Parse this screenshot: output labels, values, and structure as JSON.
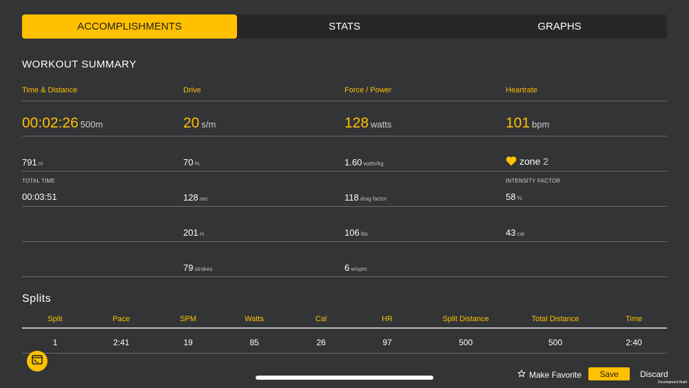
{
  "tabs": [
    {
      "label": "ACCOMPLISHMENTS",
      "active": true
    },
    {
      "label": "STATS",
      "active": false
    },
    {
      "label": "GRAPHS",
      "active": false
    }
  ],
  "summary": {
    "title": "WORKOUT SUMMARY",
    "time_distance": {
      "header": "Time & Distance",
      "main_value": "00:02:26",
      "main_unit": "500m",
      "distance_value": "791",
      "distance_unit": "m",
      "total_time_label": "TOTAL TIME",
      "total_time_value": "00:03:51"
    },
    "drive": {
      "header": "Drive",
      "main_value": "20",
      "main_unit": "s/m",
      "r1_value": "70",
      "r1_unit": "%",
      "r2_value": "128",
      "r2_unit": "sec",
      "r3_value": "201",
      "r3_unit": "m",
      "r4_value": "79",
      "r4_unit": "strokes"
    },
    "force": {
      "header": "Force / Power",
      "main_value": "128",
      "main_unit": "watts",
      "r1_value": "1.60",
      "r1_unit": "watts/kg",
      "r2_value": "118",
      "r2_unit": "drag factor",
      "r3_value": "106",
      "r3_unit": "lbs",
      "r4_value": "6",
      "r4_unit": "w/spm"
    },
    "heartrate": {
      "header": "Heartrate",
      "main_value": "101",
      "main_unit": "bpm",
      "zone_label": "zone",
      "zone_value": "2",
      "intensity_label": "INTENSITY FACTOR",
      "intensity_value": "58",
      "intensity_unit": "%",
      "cal_value": "43",
      "cal_unit": "cal"
    }
  },
  "splits": {
    "title": "Splits",
    "columns": [
      "Split",
      "Pace",
      "SPM",
      "Watts",
      "Cal",
      "HR",
      "Split Distance",
      "Total Distance",
      "Time"
    ],
    "rows": [
      [
        "1",
        "2:41",
        "19",
        "85",
        "26",
        "97",
        "500",
        "500",
        "2:40"
      ]
    ]
  },
  "footer": {
    "favorite_label": "Make Favorite",
    "save_label": "Save",
    "discard_label": "Discard",
    "dev_build": "Development Build"
  },
  "colors": {
    "accent": "#ffc000",
    "background": "#333436"
  },
  "icons": {
    "fab": "terminal-icon",
    "favorite": "star-outline-icon",
    "zone": "heart-icon"
  }
}
